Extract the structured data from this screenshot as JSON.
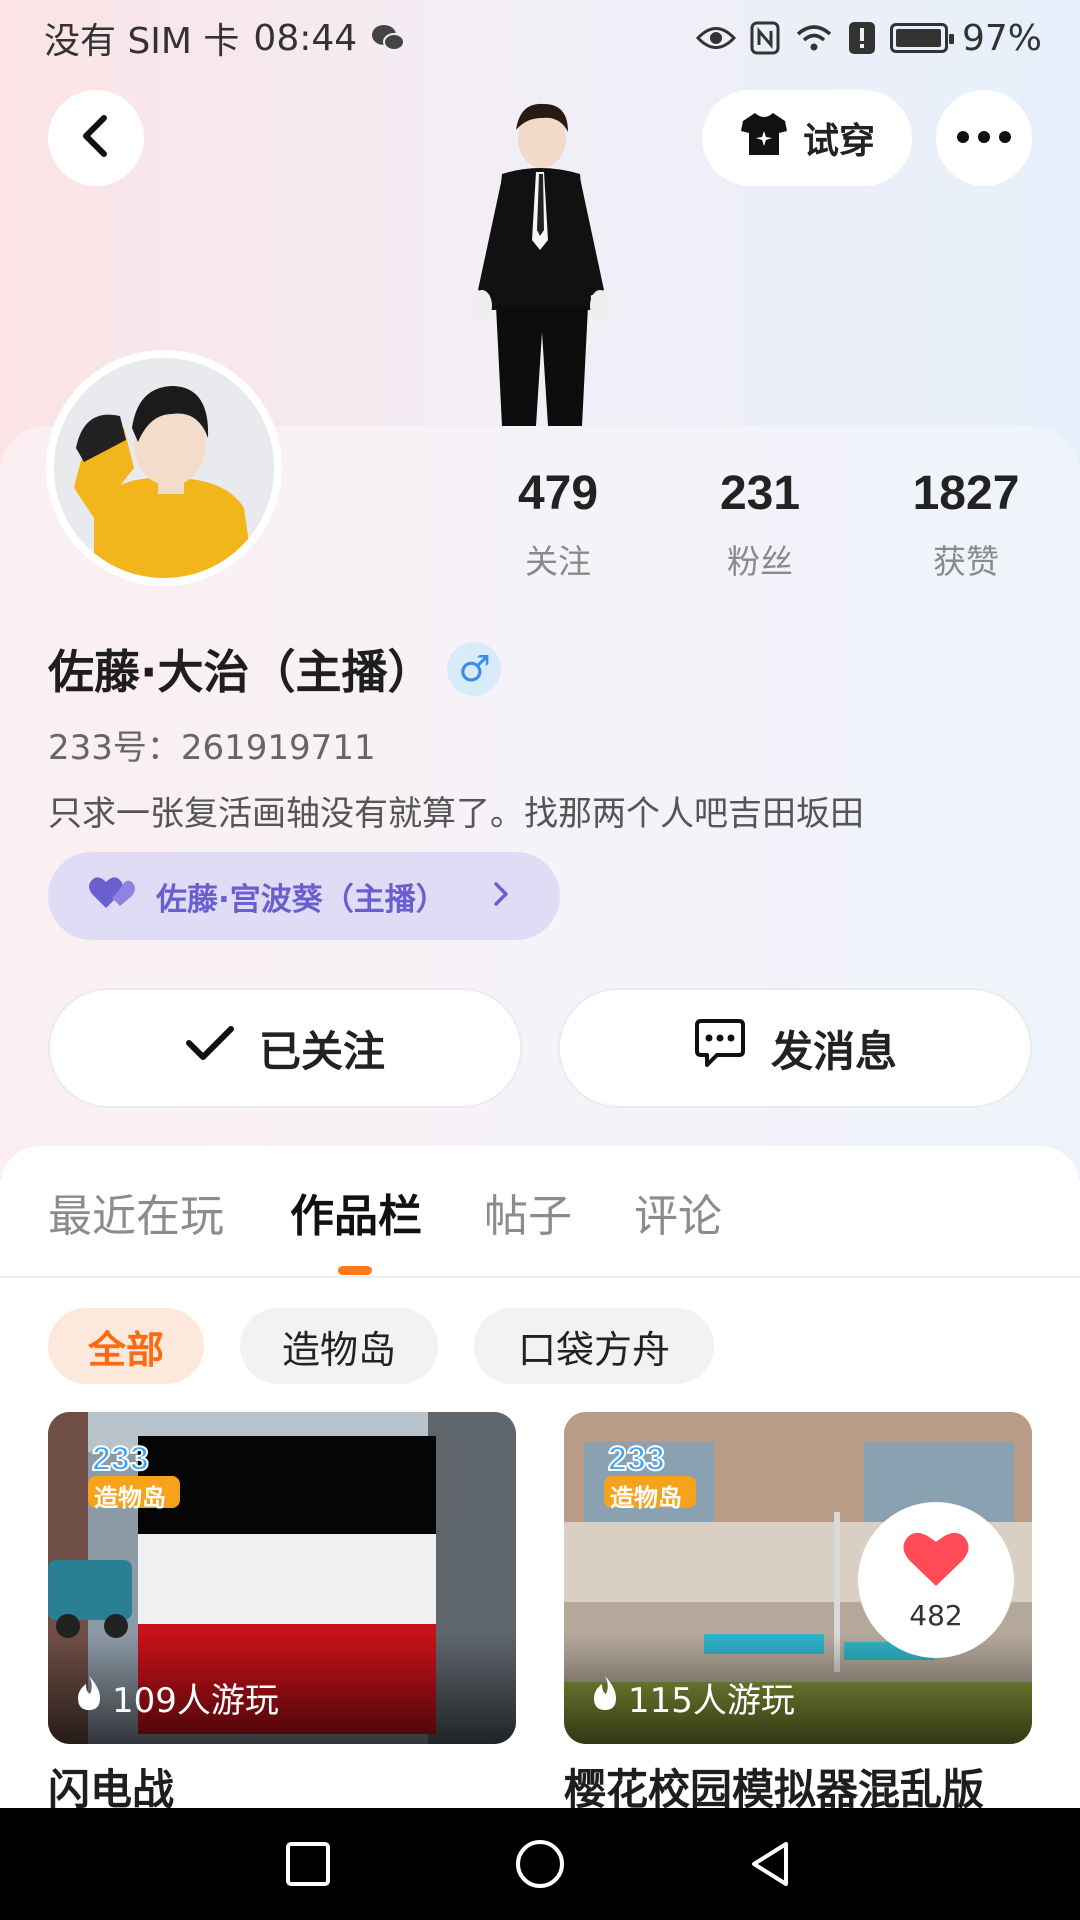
{
  "status_bar": {
    "carrier": "没有 SIM 卡",
    "time": "08:44",
    "battery_percent": "97%",
    "battery_level": 0.97,
    "icons": [
      "wechat-icon",
      "eye-icon",
      "nfc-icon",
      "wifi-icon",
      "alert-icon",
      "battery-icon"
    ]
  },
  "header": {
    "try_on_label": "试穿",
    "back_icon": "back-arrow-icon",
    "more_icon": "more-dots-icon"
  },
  "profile": {
    "stats": [
      {
        "value": "479",
        "label": "关注"
      },
      {
        "value": "231",
        "label": "粉丝"
      },
      {
        "value": "1827",
        "label": "获赞"
      }
    ],
    "name": "佐藤·大治（主播）",
    "gender_symbol": "♂",
    "uid": "233号：261919711",
    "bio": "只求一张复活画轴没有就算了。找那两个人吧吉田坂田",
    "partner_name": "佐藤·宫波葵（主播）"
  },
  "actions": {
    "follow_label": "已关注",
    "message_label": "发消息"
  },
  "tabs": [
    {
      "label": "最近在玩",
      "active": false
    },
    {
      "label": "作品栏",
      "active": true
    },
    {
      "label": "帖子",
      "active": false
    },
    {
      "label": "评论",
      "active": false
    }
  ],
  "filters": [
    {
      "label": "全部",
      "active": true
    },
    {
      "label": "造物岛",
      "active": false
    },
    {
      "label": "口袋方舟",
      "active": false
    }
  ],
  "works": [
    {
      "title": "闪电战",
      "plays": "109人游玩",
      "badge_top": "233",
      "badge_bottom": "造物岛"
    },
    {
      "title": "樱花校园模拟器混乱版",
      "plays": "115人游玩",
      "badge_top": "233",
      "badge_bottom": "造物岛",
      "likes": "482"
    }
  ],
  "colors": {
    "accent": "#ff7a1a",
    "partner_bg": "#e1dcf6",
    "partner_text": "#6b5fcf",
    "gender_bg": "#d8ebfb",
    "heart": "#ff4a57"
  }
}
